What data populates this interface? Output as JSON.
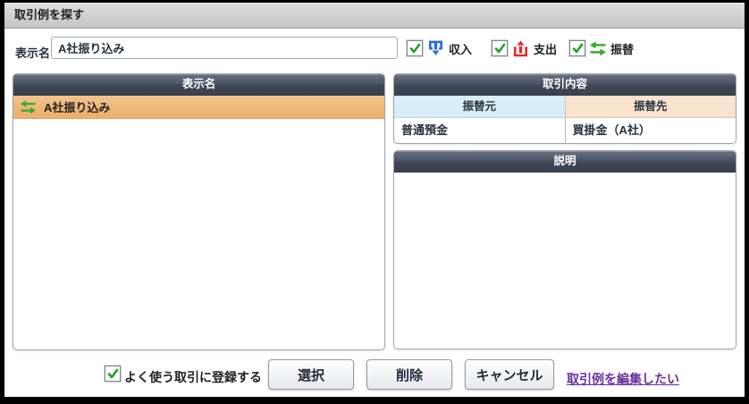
{
  "window": {
    "title": "取引例を探す"
  },
  "search": {
    "label": "表示名",
    "value": "A社振り込み"
  },
  "filters": [
    {
      "label": "収入",
      "checked": true,
      "icon": "income-icon"
    },
    {
      "label": "支出",
      "checked": true,
      "icon": "expense-icon"
    },
    {
      "label": "振替",
      "checked": true,
      "icon": "transfer-icon"
    }
  ],
  "list": {
    "header": "表示名",
    "rows": [
      {
        "label": "A社振り込み",
        "icon": "transfer-icon",
        "selected": true
      }
    ]
  },
  "detail": {
    "header": "取引内容",
    "from_header": "振替元",
    "to_header": "振替先",
    "from_value": "普通預金",
    "to_value": "買掛金（A社）",
    "description_header": "説明",
    "description_value": ""
  },
  "footer": {
    "register_label": "よく使う取引に登録する",
    "register_checked": true,
    "select_button": "選択",
    "delete_button": "削除",
    "cancel_button": "キャンセル",
    "edit_link": "取引例を編集したい"
  },
  "icons": {
    "income-icon": "blue tray with down arrow",
    "expense-icon": "red tray with up arrow",
    "transfer-icon": "green double swap arrows",
    "check-icon": "green checkmark"
  },
  "colors": {
    "header_dark": "#3f4655",
    "selected_row": "#eeb678",
    "from_header_bg": "#d8eef8",
    "to_header_bg": "#fbe3cf",
    "income_blue": "#2a6fd6",
    "expense_red": "#dd2b2b",
    "transfer_green": "#3aab2e",
    "check_green": "#1ea322",
    "link_purple": "#6a2f9e"
  }
}
